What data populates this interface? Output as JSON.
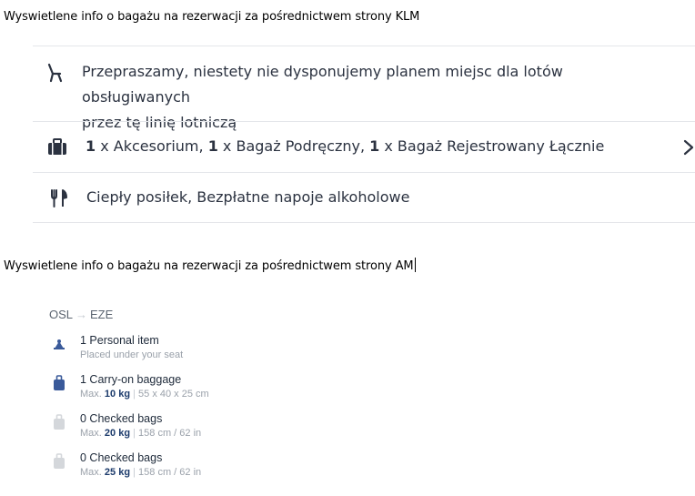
{
  "captions": {
    "klm": "Wyswietlene info o bagażu na rezerwacji za pośrednictwem strony KLM",
    "am": "Wyswietlene info o bagażu na rezerwacji za pośrednictwem strony AM"
  },
  "klm": {
    "seat": {
      "icon": "seat-icon",
      "line1": "Przepraszamy, niestety nie dysponujemy planem miejsc dla lotów obsługiwanych",
      "line2": "przez tę linię lotniczą"
    },
    "baggage": {
      "icon": "suitcase-icon",
      "q1": "1",
      "l1": " x Akcesorium, ",
      "q2": "1",
      "l2": " x Bagaż Podręczny, ",
      "q3": "1",
      "l3": " x Bagaż Rejestrowany Łącznie"
    },
    "meal": {
      "icon": "cutlery-icon",
      "text": "Ciepły posiłek, Bezpłatne napoje alkoholowe"
    }
  },
  "am": {
    "route": {
      "from": "OSL",
      "arrow": "→",
      "to": "EZE"
    },
    "items": [
      {
        "title": "1 Personal item",
        "detail_text": "Placed under your seat",
        "icon": "personal-item-icon",
        "color": "#3a5a9a"
      },
      {
        "title": "1 Carry-on baggage",
        "pre": "Max. ",
        "weight": "10 kg",
        "sep": " | ",
        "dims": "55 x 40 x 25 cm",
        "icon": "carry-on-icon",
        "color": "#3a5a9a"
      },
      {
        "title": "0 Checked bags",
        "pre": "Max. ",
        "weight": "20 kg",
        "sep": " | ",
        "dims": "158 cm / 62 in",
        "icon": "checked-bag-icon",
        "color": "#d4d7db"
      },
      {
        "title": "0 Checked bags",
        "pre": "Max. ",
        "weight": "25 kg",
        "sep": " | ",
        "dims": "158 cm / 62 in",
        "icon": "checked-bag-icon",
        "color": "#d4d7db"
      }
    ]
  }
}
